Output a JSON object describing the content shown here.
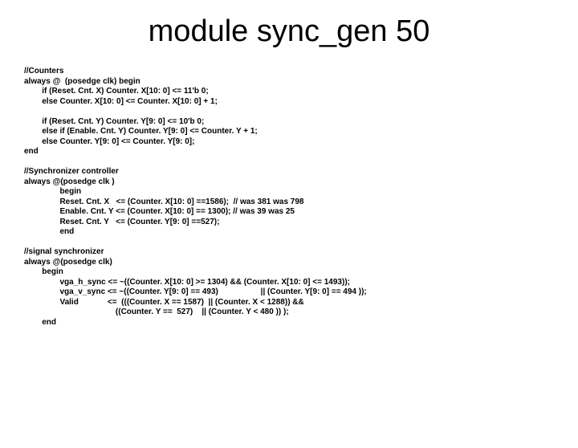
{
  "title": "module sync_gen 50",
  "code": "//Counters\nalways @  (posedge clk) begin\n        if (Reset. Cnt. X) Counter. X[10: 0] <= 11'b 0;\n        else Counter. X[10: 0] <= Counter. X[10: 0] + 1;\n\n        if (Reset. Cnt. Y) Counter. Y[9: 0] <= 10'b 0;\n        else if (Enable. Cnt. Y) Counter. Y[9: 0] <= Counter. Y + 1;\n        else Counter. Y[9: 0] <= Counter. Y[9: 0];\nend\n\n//Synchronizer controller\nalways @(posedge clk )\n                begin\n                Reset. Cnt. X   <= (Counter. X[10: 0] ==1586);  // was 381 was 798\n                Enable. Cnt. Y <= (Counter. X[10: 0] == 1300); // was 39 was 25\n                Reset. Cnt. Y   <= (Counter. Y[9: 0] ==527);\n                end\n\n//signal synchronizer\nalways @(posedge clk)\n        begin\n                vga_h_sync <= ~((Counter. X[10: 0] >= 1304) && (Counter. X[10: 0] <= 1493));\n                vga_v_sync <= ~((Counter. Y[9: 0] == 493)                   || (Counter. Y[9: 0] == 494 ));\n                Valid             <=  (((Counter. X == 1587)  || (Counter. X < 1288)) &&\n                                         ((Counter. Y ==  527)    || (Counter. Y < 480 )) );\n        end"
}
